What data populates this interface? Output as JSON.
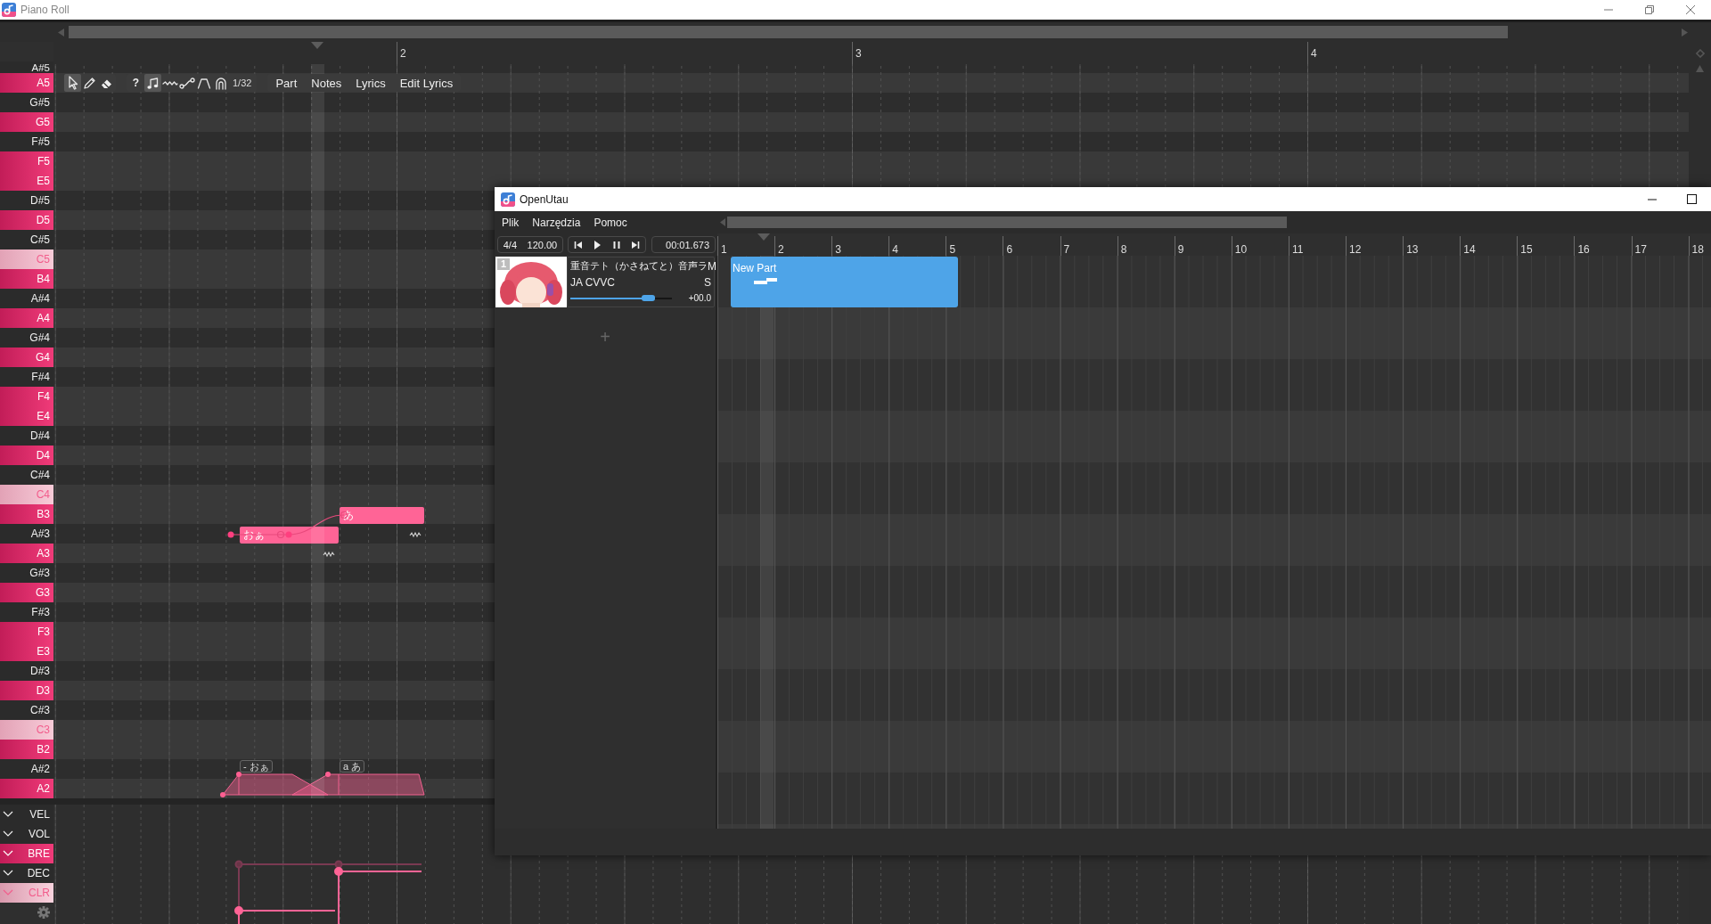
{
  "piano_roll": {
    "title": "Piano Roll",
    "ruler": [
      "2",
      "3",
      "4"
    ],
    "keys": [
      {
        "label": "A#5",
        "kind": "black"
      },
      {
        "label": "A5",
        "kind": "white"
      },
      {
        "label": "G#5",
        "kind": "black"
      },
      {
        "label": "G5",
        "kind": "white"
      },
      {
        "label": "F#5",
        "kind": "black"
      },
      {
        "label": "F5",
        "kind": "white"
      },
      {
        "label": "E5",
        "kind": "white"
      },
      {
        "label": "D#5",
        "kind": "black"
      },
      {
        "label": "D5",
        "kind": "white"
      },
      {
        "label": "C#5",
        "kind": "black"
      },
      {
        "label": "C5",
        "kind": "c"
      },
      {
        "label": "B4",
        "kind": "white"
      },
      {
        "label": "A#4",
        "kind": "black"
      },
      {
        "label": "A4",
        "kind": "white"
      },
      {
        "label": "G#4",
        "kind": "black"
      },
      {
        "label": "G4",
        "kind": "white"
      },
      {
        "label": "F#4",
        "kind": "black"
      },
      {
        "label": "F4",
        "kind": "white"
      },
      {
        "label": "E4",
        "kind": "white"
      },
      {
        "label": "D#4",
        "kind": "black"
      },
      {
        "label": "D4",
        "kind": "white"
      },
      {
        "label": "C#4",
        "kind": "black"
      },
      {
        "label": "C4",
        "kind": "c"
      },
      {
        "label": "B3",
        "kind": "white"
      },
      {
        "label": "A#3",
        "kind": "black"
      },
      {
        "label": "A3",
        "kind": "white"
      },
      {
        "label": "G#3",
        "kind": "black"
      },
      {
        "label": "G3",
        "kind": "white"
      },
      {
        "label": "F#3",
        "kind": "black"
      },
      {
        "label": "F3",
        "kind": "white"
      },
      {
        "label": "E3",
        "kind": "white"
      },
      {
        "label": "D#3",
        "kind": "black"
      },
      {
        "label": "D3",
        "kind": "white"
      },
      {
        "label": "C#3",
        "kind": "black"
      },
      {
        "label": "C3",
        "kind": "c"
      },
      {
        "label": "B2",
        "kind": "white"
      },
      {
        "label": "A#2",
        "kind": "black"
      },
      {
        "label": "A2",
        "kind": "white"
      }
    ],
    "tools": [
      {
        "kind": "select",
        "selected": true
      },
      {
        "kind": "pencil",
        "selected": false
      },
      {
        "kind": "eraser",
        "selected": false
      }
    ],
    "help": "?",
    "toggles": [
      {
        "kind": "note",
        "selected": true
      },
      {
        "kind": "vibrato",
        "selected": false
      },
      {
        "kind": "pitch",
        "selected": false
      },
      {
        "kind": "envelope",
        "selected": false
      },
      {
        "kind": "phoneme",
        "selected": false
      }
    ],
    "snap": "1/32",
    "tabs": [
      "Part",
      "Notes",
      "Lyrics",
      "Edit Lyrics"
    ],
    "notes": [
      {
        "lyric": "おぁ"
      },
      {
        "lyric": "あ"
      }
    ],
    "phonemes": [
      "- おぁ",
      "a あ"
    ],
    "expressions": [
      {
        "label": "VEL",
        "kind": "plain"
      },
      {
        "label": "VOL",
        "kind": "plain"
      },
      {
        "label": "BRE",
        "kind": "active"
      },
      {
        "label": "DEC",
        "kind": "plain"
      },
      {
        "label": "CLR",
        "kind": "secondary"
      }
    ]
  },
  "openutau": {
    "title": "OpenUtau",
    "menu": [
      "Plik",
      "Narzędzia",
      "Pomoc"
    ],
    "time_signature": "4/4",
    "tempo": "120.00",
    "time": "00:01.673",
    "ruler": [
      "1",
      "2",
      "3",
      "4",
      "5",
      "6",
      "7",
      "8",
      "9",
      "10",
      "11",
      "12",
      "13",
      "14",
      "15",
      "16",
      "17",
      "18"
    ],
    "tracks": [
      {
        "number": "1",
        "singer": "重音テト（かさねてと）音声ラ",
        "phonemizer": "JA CVVC",
        "mute": "M",
        "solo": "S",
        "level": 0.77,
        "volume": "+00.0"
      }
    ],
    "add_track": "+",
    "parts": [
      {
        "name": "New Part"
      }
    ]
  }
}
